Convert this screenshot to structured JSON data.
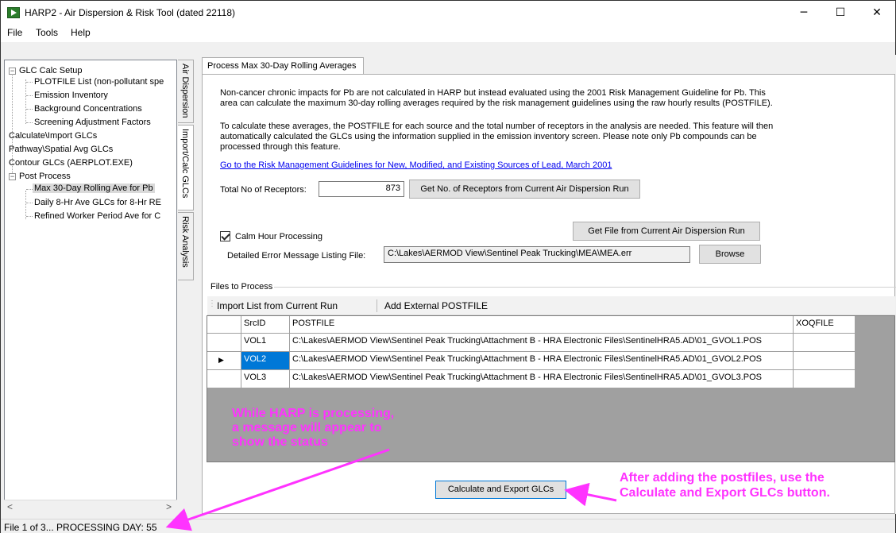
{
  "window": {
    "title": "HARP2 - Air Dispersion & Risk Tool (dated 22118)",
    "minimize": "─",
    "maximize": "☐",
    "close": "✕"
  },
  "menu": [
    "File",
    "Tools",
    "Help"
  ],
  "tree": {
    "items": [
      {
        "label": "GLC Calc Setup",
        "toggle": "−"
      },
      {
        "label": "PLOTFILE List (non-pollutant spe"
      },
      {
        "label": "Emission Inventory"
      },
      {
        "label": "Background Concentrations"
      },
      {
        "label": "Screening Adjustment Factors"
      },
      {
        "label": "Calculate\\Import GLCs"
      },
      {
        "label": "Pathway\\Spatial Avg GLCs"
      },
      {
        "label": "Contour GLCs (AERPLOT.EXE)"
      },
      {
        "label": "Post Process",
        "toggle": "−"
      },
      {
        "label": "Max 30-Day Rolling Ave for Pb"
      },
      {
        "label": "Daily 8-Hr Ave GLCs for 8-Hr RE"
      },
      {
        "label": "Refined Worker Period Ave for C"
      }
    ],
    "scroll_left": "<",
    "scroll_right": ">"
  },
  "side_tabs": [
    "Air Dispersion",
    "Import/Calc GLCs",
    "Risk Analysis"
  ],
  "tab": {
    "label": "Process Max 30-Day Rolling Averages"
  },
  "content": {
    "para1_line1": "Non-cancer chronic impacts for Pb are not calculated in HARP but instead evaluated using the 2001 Risk Management Guideline for Pb.  This",
    "para1_line2": "area can calculate the maximum 30-day rolling averages required by the risk management guidelines using the raw hourly results (POSTFILE).",
    "para2_line1": "To calculate these averages, the POSTFILE for each source and the total number of receptors in the analysis are needed.  This feature will then",
    "para2_line2": "automatically calculated the GLCs using the information supplied in the emission inventory screen.  Please note only Pb compounds can be",
    "para2_line3": "processed through this feature.",
    "link": "Go to the Risk Management Guidelines for New, Modified, and Existing Sources of Lead, March 2001",
    "receptors_label": "Total No of Receptors:",
    "receptors_value": "873",
    "get_receptors_button": "Get No. of Receptors from Current Air Dispersion Run",
    "get_file_button": "Get File from Current Air Dispersion Run",
    "calm_label": "Calm Hour Processing",
    "calm_checked": true,
    "error_file_label": "Detailed Error Message Listing File:",
    "error_file_value": "C:\\Lakes\\AERMOD View\\Sentinel Peak Trucking\\MEA\\MEA.err",
    "browse_button": "Browse",
    "files_group": "Files to Process",
    "import_list_button": "Import List from Current Run",
    "add_external_button": "Add External POSTFILE",
    "calculate_button": "Calculate and Export GLCs"
  },
  "grid": {
    "columns": [
      "SrcID",
      "POSTFILE",
      "XOQFILE"
    ],
    "rows": [
      {
        "src": "VOL1",
        "postfile": "C:\\Lakes\\AERMOD View\\Sentinel Peak Trucking\\Attachment B - HRA Electronic Files\\SentinelHRA5.AD\\01_GVOL1.POS",
        "xoq": "",
        "selected": false
      },
      {
        "src": "VOL2",
        "postfile": "C:\\Lakes\\AERMOD View\\Sentinel Peak Trucking\\Attachment B - HRA Electronic Files\\SentinelHRA5.AD\\01_GVOL2.POS",
        "xoq": "",
        "selected": true
      },
      {
        "src": "VOL3",
        "postfile": "C:\\Lakes\\AERMOD View\\Sentinel Peak Trucking\\Attachment B - HRA Electronic Files\\SentinelHRA5.AD\\01_GVOL3.POS",
        "xoq": "",
        "selected": false
      }
    ],
    "current_row_marker": "▶"
  },
  "annotations": {
    "processing_line1": "While HARP is processing,",
    "processing_line2": "a message will appear to",
    "processing_line3": "show the status",
    "button_line1": "After adding the postfiles, use the",
    "button_line2": "Calculate and Export GLCs button.",
    "color": "#ff33ff"
  },
  "status": {
    "text": "File 1 of 3... PROCESSING DAY: 55"
  }
}
